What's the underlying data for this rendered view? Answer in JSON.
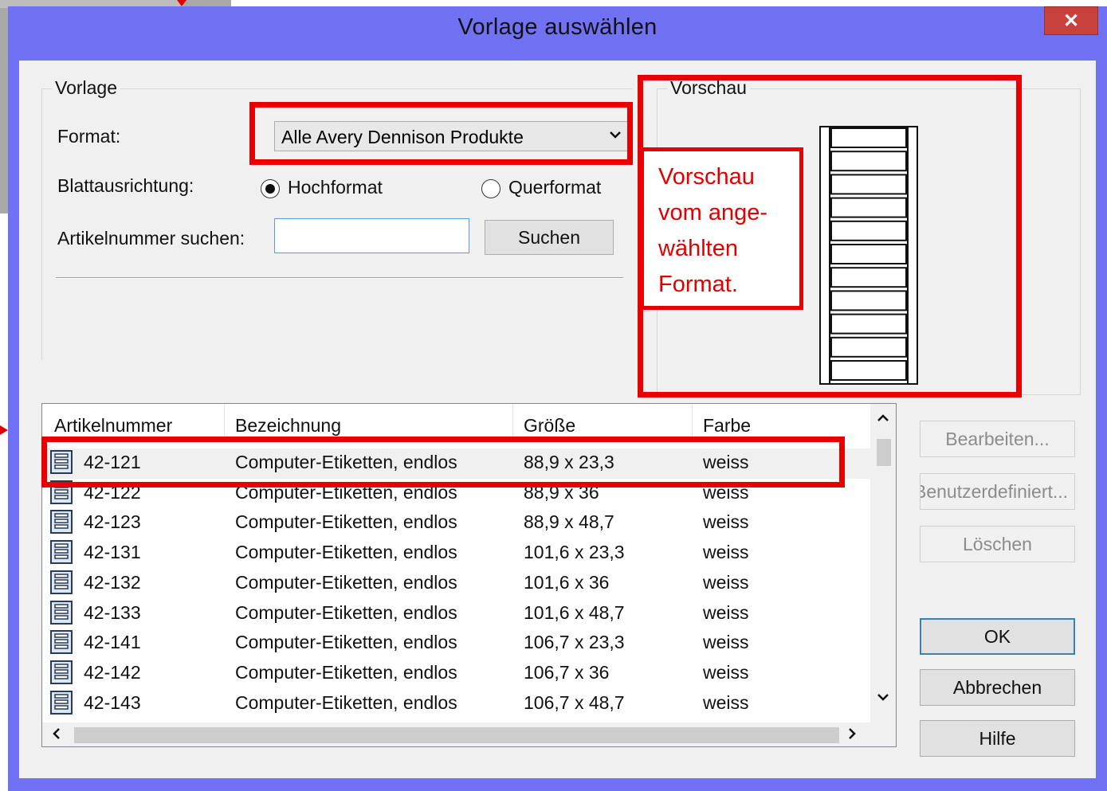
{
  "dialog": {
    "title": "Vorlage auswählen",
    "close_glyph": "✕"
  },
  "vorlage": {
    "legend": "Vorlage",
    "format_label": "Format:",
    "format_value": "Alle Avery Dennison Produkte",
    "orientation_label": "Blattausrichtung:",
    "portrait_label": "Hochformat",
    "landscape_label": "Querformat",
    "orientation_selected": "Hochformat",
    "search_label": "Artikelnummer suchen:",
    "search_value": "",
    "search_button": "Suchen"
  },
  "preview": {
    "legend": "Vorschau",
    "label_count": 11,
    "annotation_lines": [
      "Vorschau",
      "vom ange-",
      "wählten",
      "Format."
    ]
  },
  "list": {
    "columns": [
      "Artikelnummer",
      "Bezeichnung",
      "Größe",
      "Farbe"
    ],
    "rows": [
      {
        "nr": "42-121",
        "name": "Computer-Etiketten, endlos",
        "size": "88,9 x 23,3",
        "color": "weiss",
        "selected": true
      },
      {
        "nr": "42-122",
        "name": "Computer-Etiketten, endlos",
        "size": "88,9 x 36",
        "color": "weiss"
      },
      {
        "nr": "42-123",
        "name": "Computer-Etiketten, endlos",
        "size": "88,9 x 48,7",
        "color": "weiss"
      },
      {
        "nr": "42-131",
        "name": "Computer-Etiketten, endlos",
        "size": "101,6 x 23,3",
        "color": "weiss"
      },
      {
        "nr": "42-132",
        "name": "Computer-Etiketten, endlos",
        "size": "101,6 x 36",
        "color": "weiss"
      },
      {
        "nr": "42-133",
        "name": "Computer-Etiketten, endlos",
        "size": "101,6 x 48,7",
        "color": "weiss"
      },
      {
        "nr": "42-141",
        "name": "Computer-Etiketten, endlos",
        "size": "106,7 x 23,3",
        "color": "weiss"
      },
      {
        "nr": "42-142",
        "name": "Computer-Etiketten, endlos",
        "size": "106,7 x 36",
        "color": "weiss"
      },
      {
        "nr": "42-143",
        "name": "Computer-Etiketten, endlos",
        "size": "106,7 x 48,7",
        "color": "weiss"
      }
    ],
    "row_icon": "label-sheet-icon"
  },
  "buttons": {
    "edit": "Bearbeiten...",
    "custom": "Benutzerdefiniert...",
    "delete": "Löschen",
    "ok": "OK",
    "cancel": "Abbrechen",
    "help": "Hilfe"
  },
  "colors": {
    "frame": "#7171f3",
    "close": "#c7413d",
    "annotation": "#e80000"
  }
}
